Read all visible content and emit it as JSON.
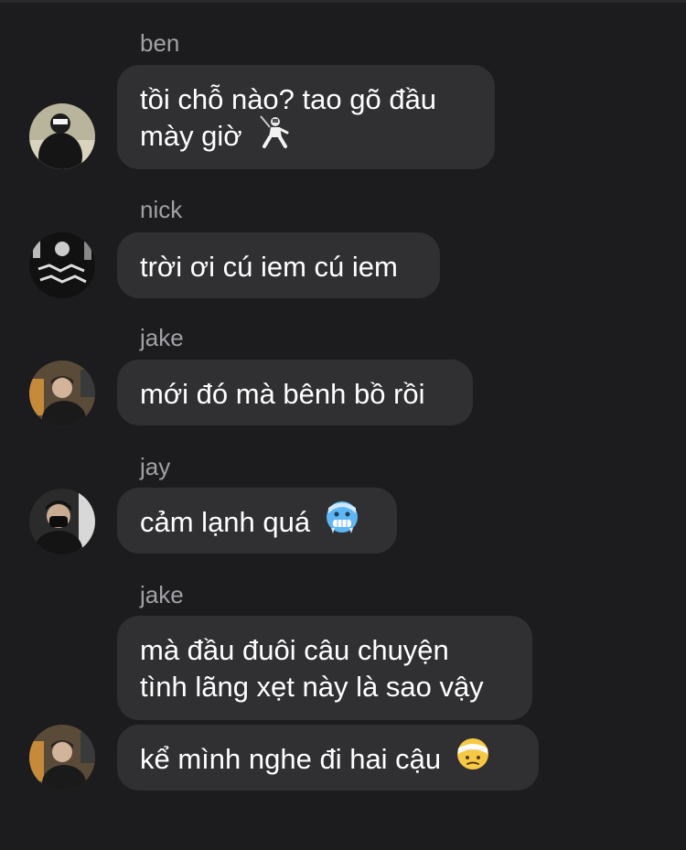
{
  "messages": [
    {
      "sender": "ben",
      "lines": [
        "tồi chỗ nào? tao gõ đầu",
        "mày giờ"
      ],
      "emoji": "fencer-icon"
    },
    {
      "sender": "nick",
      "lines": [
        "trời ơi cú iem cú iem"
      ]
    },
    {
      "sender": "jake",
      "lines": [
        "mới đó mà bênh bồ rồi"
      ]
    },
    {
      "sender": "jay",
      "lines": [
        "cảm lạnh quá"
      ],
      "emoji": "cold-face-icon"
    },
    {
      "sender": "jake",
      "lines": [
        "mà đầu đuôi câu chuyện",
        "tình lãng xẹt này là sao vậy"
      ]
    },
    {
      "lines": [
        "kể mình nghe đi hai cậu"
      ],
      "emoji": "bandaged-face-icon"
    }
  ]
}
